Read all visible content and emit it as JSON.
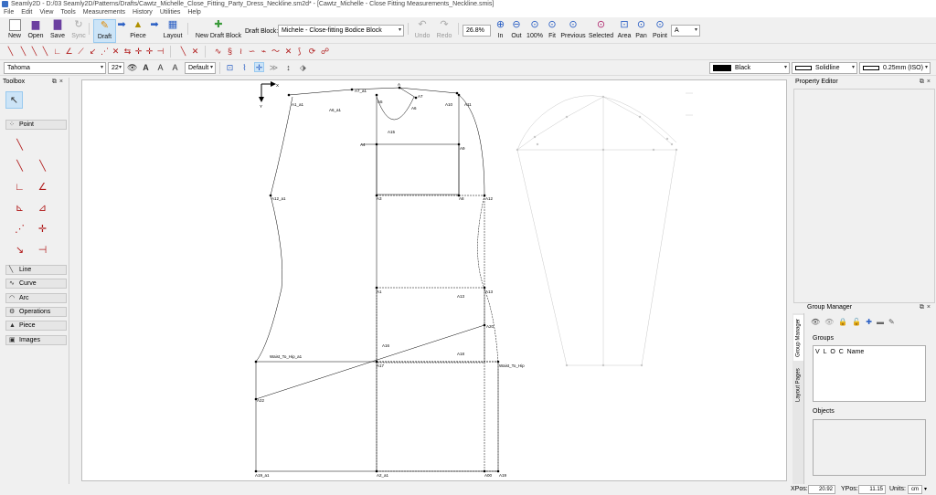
{
  "window": {
    "title": "Seamly2D - D:/03 Seamly2D/Patterns/Drafts/Cawtz_Michelle_Close_Fitting_Party_Dress_Neckline.sm2d* - [Cawtz_Michelle - Close Fitting Measurements_Neckline.smis]"
  },
  "menu": [
    "File",
    "Edit",
    "View",
    "Tools",
    "Measurements",
    "History",
    "Utilities",
    "Help"
  ],
  "toolbar": {
    "new_label": "New",
    "open_label": "Open",
    "save_label": "Save",
    "sync_label": "Sync",
    "draft_label": "Draft",
    "piece_label": "Piece",
    "layout_label": "Layout",
    "new_draft_block_label": "New Draft Block",
    "draft_block_label": "Draft Block:",
    "draft_block_value": "Michele - Close-fitting Bodice Block",
    "undo_label": "Undo",
    "redo_label": "Redo",
    "zoom_value": "26.8%",
    "zoom_in_label": "In",
    "zoom_out_label": "Out",
    "zoom_100_label": "100%",
    "fit_label": "Fit",
    "previous_label": "Previous",
    "selected_label": "Selected",
    "area_label": "Area",
    "pan_label": "Pan",
    "point_label": "Point",
    "point_combo_value": "A"
  },
  "textbar": {
    "font_value": "Tahoma",
    "size_value": "22",
    "style_value": "Default",
    "color_value": "Black",
    "line_type_value": "Solidline",
    "line_weight_value": "0.25mm (ISO)"
  },
  "toolbox": {
    "title": "Toolbox",
    "sections": [
      "Point",
      "Line",
      "Curve",
      "Arc",
      "Operations",
      "Piece",
      "Images"
    ]
  },
  "property_editor": {
    "title": "Property Editor"
  },
  "group_manager": {
    "title": "Group Manager",
    "groups_label": "Groups",
    "columns": [
      "V",
      "L",
      "O",
      "C",
      "Name"
    ],
    "objects_label": "Objects",
    "side_tabs": [
      "Group Manager",
      "Layout Pages"
    ]
  },
  "statusbar": {
    "xpos_label": "XPos:",
    "xpos_value": "20.92",
    "ypos_label": "YPos:",
    "ypos_value": "11.15",
    "units_label": "Units:",
    "units_value": "cm"
  },
  "canvas": {
    "axis_x_label": "X",
    "axis_y_label": "Y",
    "labels": {
      "a": "A",
      "a7_a1": "A7_a1",
      "a7": "A7",
      "a6": "A6",
      "a5": "A5",
      "a10": "A10",
      "a11": "A11",
      "a1_a1": "A1_a1",
      "a6_a1": "A6_a1",
      "a15": "A15",
      "a4": "A4",
      "a9": "A9",
      "a3": "A3",
      "a8": "A8",
      "a12": "A12",
      "a12_a1": "A12_a1",
      "a1": "A1",
      "a13": "A13",
      "a13b": "A13",
      "a20": "A20",
      "a18": "A18",
      "a16": "A16",
      "a17": "A17",
      "waist_hip_a1": "Waist_To_Hip_a1",
      "waist_hip": "Waist_To_Hip",
      "a22": "A22",
      "a19_a1": "A19_a1",
      "a2_a1": "A2_a1",
      "a00": "A00",
      "a19": "A19"
    }
  }
}
